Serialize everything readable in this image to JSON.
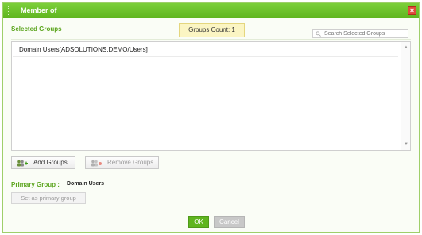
{
  "dialog": {
    "title": "Member of",
    "close_glyph": "×"
  },
  "selected": {
    "label": "Selected Groups",
    "count_label": "Groups Count: 1",
    "search_placeholder": "Search Selected Groups"
  },
  "groups": [
    {
      "name": "Domain Users[ADSOLUTIONS.DEMO/Users]"
    }
  ],
  "buttons": {
    "add": "Add Groups",
    "remove": "Remove Groups",
    "set_primary": "Set as primary group",
    "ok": "OK",
    "cancel": "Cancel"
  },
  "primary": {
    "label": "Primary Group :",
    "value": "Domain Users"
  },
  "colors": {
    "accent": "#5fb51f",
    "title_bar": "#6cc22b",
    "close": "#e04a3b",
    "badge_bg": "#fbf5c3"
  },
  "icons": {
    "close": "close-icon",
    "search": "search-icon",
    "add": "group-add-icon",
    "remove": "group-remove-icon"
  }
}
